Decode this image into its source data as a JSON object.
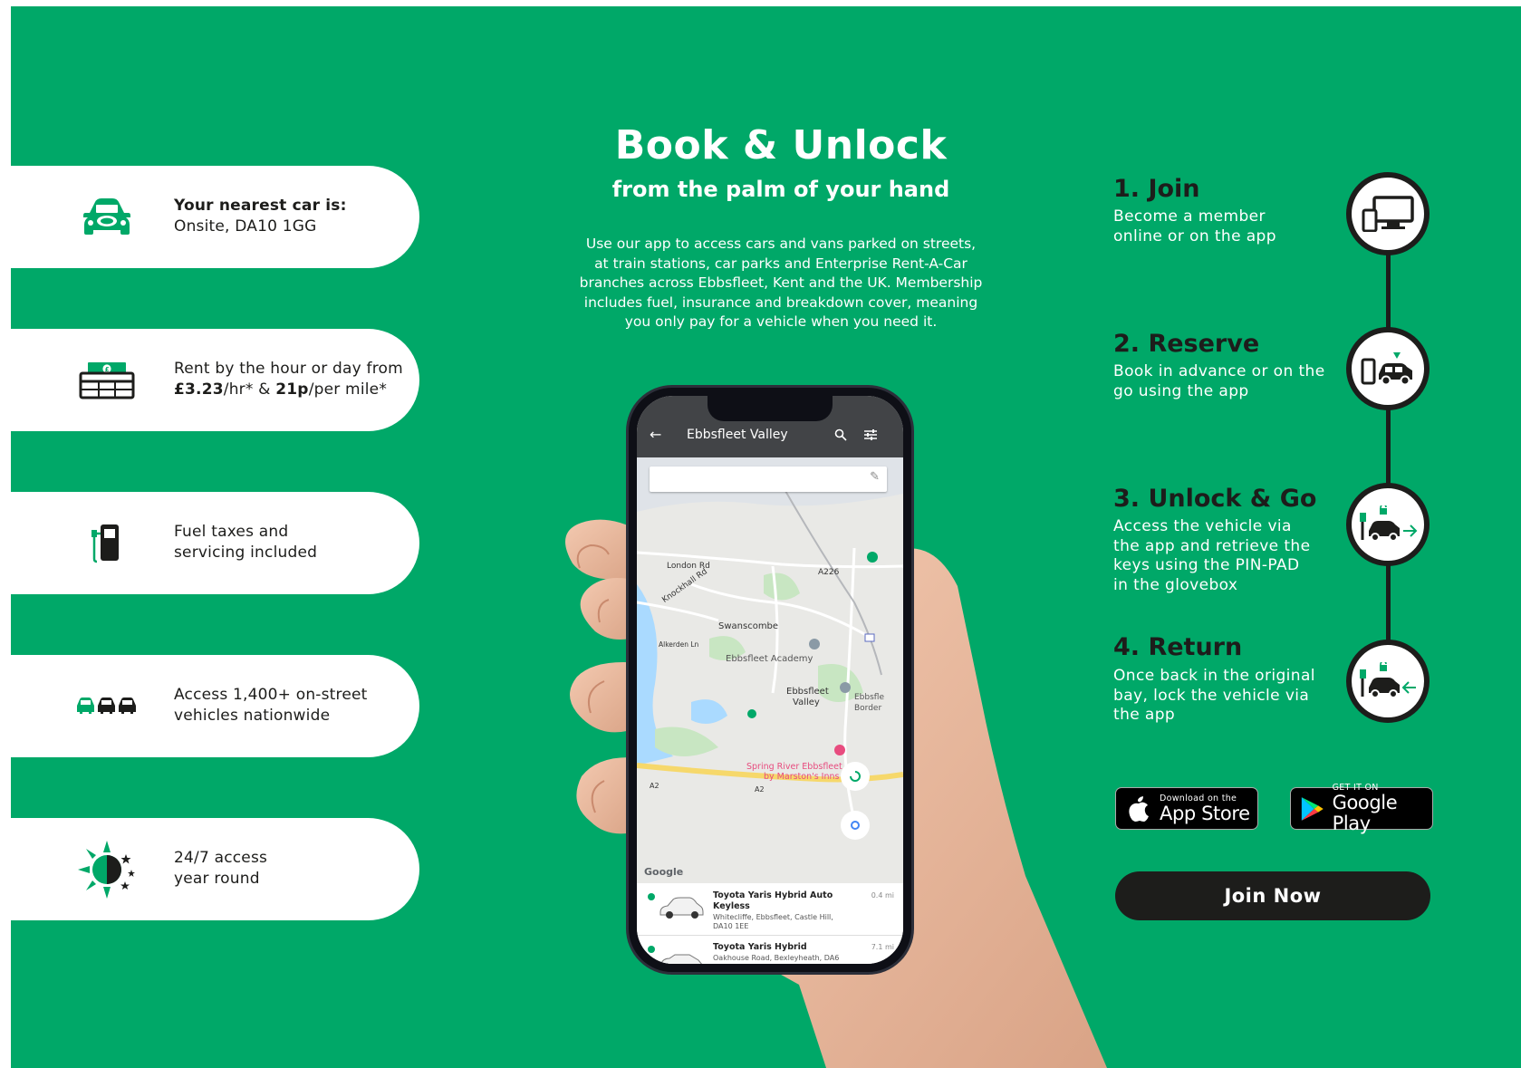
{
  "colors": {
    "brand_green": "#00a868",
    "dark": "#1d1d1b",
    "white": "#ffffff"
  },
  "features": [
    {
      "icon": "car-front-icon",
      "bold": "Your nearest car is:",
      "line2": "Onsite, DA10 1GG"
    },
    {
      "icon": "cash-icon",
      "line1": "Rent by the hour or day from",
      "price_hr": "£3.23",
      "price_hr_suffix": "/hr* & ",
      "price_mile": "21p",
      "price_mile_suffix": "/per mile*"
    },
    {
      "icon": "fuel-pump-icon",
      "line1": "Fuel taxes and",
      "line2": "servicing included"
    },
    {
      "icon": "cars-icon",
      "line1": "Access 1,400+ on-street",
      "line2": "vehicles nationwide"
    },
    {
      "icon": "day-night-icon",
      "line1": "24/7 access",
      "line2": "year round"
    }
  ],
  "hero": {
    "title": "Book & Unlock",
    "subtitle": "from the palm of your hand",
    "body": [
      "Use our app to access cars and vans parked on streets,",
      "at train stations, car parks and Enterprise Rent-A-Car",
      "branches across Ebbsfleet, Kent and the UK. Membership",
      "includes fuel, insurance and breakdown cover, meaning",
      "you only pay for a vehicle when you need it."
    ]
  },
  "phone": {
    "app_title": "Ebbsfleet Valley",
    "map_labels": {
      "london_rd": "London Rd",
      "knockhall": "Knockhall Rd",
      "a226": "A226",
      "swanscombe": "Swanscombe",
      "alkerden": "Alkerden Ln",
      "academy": "Ebbsfleet Academy",
      "valley1": "Ebbsfleet",
      "valley2": "Valley",
      "border1": "Ebbsfle",
      "border2": "Border",
      "spring1": "Spring River Ebbsfleet",
      "spring2": "by Marston's Inns",
      "a2a": "A2",
      "a2b": "A2",
      "google": "Google"
    },
    "cars": [
      {
        "name": "Toyota Yaris Hybrid Auto",
        "name2": "Keyless",
        "address": "Whitecliffe, Ebbsfleet, Castle Hill,",
        "address2": "DA10 1EE",
        "distance": "0.4 mi"
      },
      {
        "name": "Toyota Yaris Hybrid",
        "address": "Oakhouse Road, Bexleyheath, DA6",
        "distance": "7.1 mi"
      }
    ]
  },
  "steps": [
    {
      "title": "1. Join",
      "desc": [
        "Become a member",
        "online or on the app"
      ],
      "icon": "devices-icon"
    },
    {
      "title": "2. Reserve",
      "desc": [
        "Book in advance or on the",
        "go using the app"
      ],
      "icon": "phone-car-icon"
    },
    {
      "title": "3. Unlock & Go",
      "desc": [
        "Access the vehicle via",
        "the app and retrieve the",
        "keys using the PIN-PAD",
        "in the glovebox"
      ],
      "icon": "unlock-go-icon"
    },
    {
      "title": "4. Return",
      "desc": [
        "Once back in the original",
        "bay, lock the vehicle via",
        "the app"
      ],
      "icon": "return-icon"
    }
  ],
  "stores": {
    "apple_small": "Download on the",
    "apple_big": "App Store",
    "google_small": "GET IT ON",
    "google_big": "Google Play"
  },
  "cta": {
    "join": "Join Now"
  }
}
